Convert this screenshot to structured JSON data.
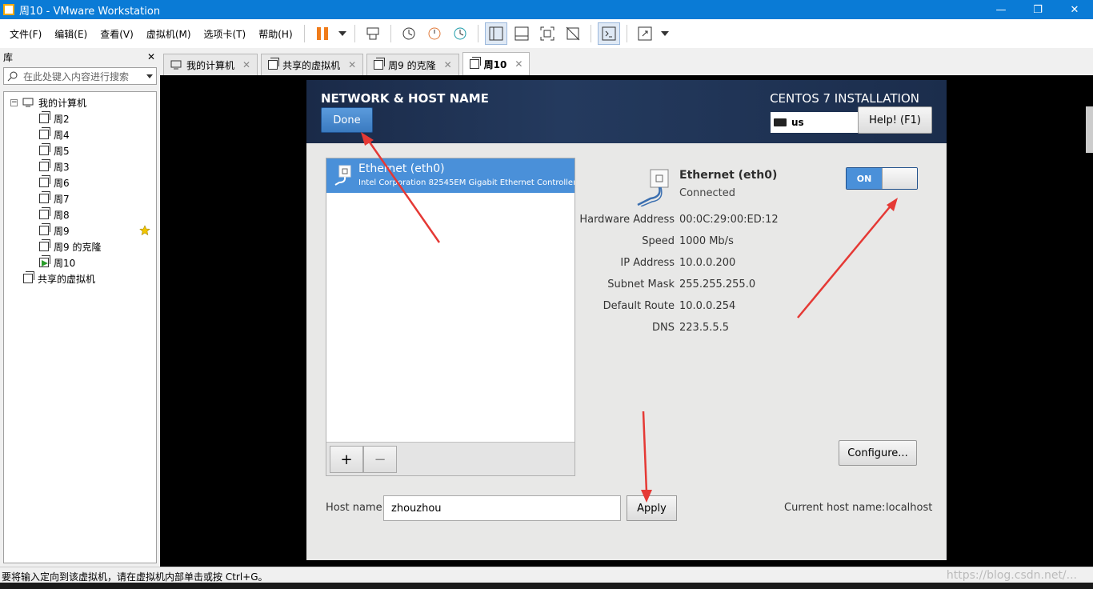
{
  "window": {
    "title": "周10 - VMware Workstation",
    "minimize": "—",
    "restore": "❐",
    "close": "✕"
  },
  "menu": [
    "文件(F)",
    "编辑(E)",
    "查看(V)",
    "虚拟机(M)",
    "选项卡(T)",
    "帮助(H)"
  ],
  "library": {
    "title": "库",
    "close": "✕",
    "search_placeholder": "在此处键入内容进行搜索",
    "root": "我的计算机",
    "vms": [
      "周2",
      "周4",
      "周5",
      "周3",
      "周6",
      "周7",
      "周8",
      "周9",
      "周9 的克隆",
      "周10"
    ],
    "shared": "共享的虚拟机"
  },
  "tabs": [
    {
      "label": "我的计算机",
      "close": "✕"
    },
    {
      "label": "共享的虚拟机",
      "close": "✕"
    },
    {
      "label": "周9 的克隆",
      "close": "✕"
    },
    {
      "label": "周10",
      "close": "✕"
    }
  ],
  "installer": {
    "section_title": "NETWORK & HOST NAME",
    "done": "Done",
    "product": "CENTOS 7 INSTALLATION",
    "keyboard": "us",
    "help": "Help! (F1)",
    "interface": {
      "name": "Ethernet (eth0)",
      "description": "Intel Corporation 82545EM Gigabit Ethernet Controller ("
    },
    "add": "+",
    "remove": "−",
    "device": {
      "name": "Ethernet (eth0)",
      "status": "Connected",
      "switch": "ON"
    },
    "properties": [
      {
        "key": "Hardware Address",
        "value": "00:0C:29:00:ED:12"
      },
      {
        "key": "Speed",
        "value": "1000 Mb/s"
      },
      {
        "key": "IP Address",
        "value": "10.0.0.200"
      },
      {
        "key": "Subnet Mask",
        "value": "255.255.255.0"
      },
      {
        "key": "Default Route",
        "value": "10.0.0.254"
      },
      {
        "key": "DNS",
        "value": "223.5.5.5"
      }
    ],
    "configure": "Configure...",
    "host_label": "Host name:",
    "host_value": "zhouzhou",
    "apply": "Apply",
    "current_host_label": "Current host name:",
    "current_host_value": "localhost"
  },
  "status": {
    "message": "要将输入定向到该虚拟机，请在虚拟机内部单击或按 Ctrl+G。",
    "watermark": "https://blog.csdn.net/..."
  },
  "colors": {
    "titlebar": "#0a7bd6",
    "selected": "#4a90d9",
    "arrow": "#e53935"
  }
}
